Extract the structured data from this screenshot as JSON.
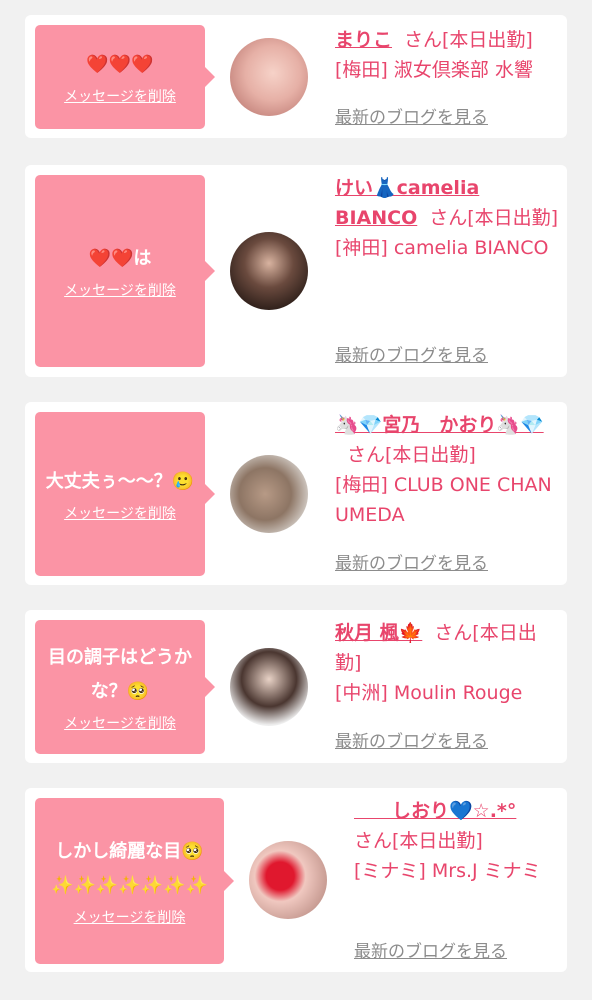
{
  "delete_label": "メッセージを削除",
  "blog_label": "最新のブログを見る",
  "cards": [
    {
      "message": "❤️❤️❤️",
      "name": "まりこ",
      "status": "さん[本日出勤]",
      "shop": "[梅田] 淑女倶楽部 水響"
    },
    {
      "message": "❤️❤️は",
      "name": "けい👗camelia BIANCO",
      "status": "さん[本日出勤]",
      "shop": "[神田] camelia BIANCO"
    },
    {
      "message": "大丈夫ぅ〜〜？🥲",
      "name": "🦄💎宮乃　かおり🦄💎",
      "status": "さん[本日出勤]",
      "shop": "[梅田] CLUB ONE CHAN UMEDA"
    },
    {
      "message": "目の調子はどうかな？🥺",
      "name": "秋月 楓🍁",
      "status": "さん[本日出勤]",
      "shop": "[中洲] Moulin Rouge"
    },
    {
      "message": "しかし綺麗な目🥺 ✨✨✨✨✨✨✨",
      "name": "　　しおり💙☆.*°",
      "status": "さん[本日出勤]",
      "shop": "[ミナミ] Mrs.J ミナミ"
    }
  ]
}
